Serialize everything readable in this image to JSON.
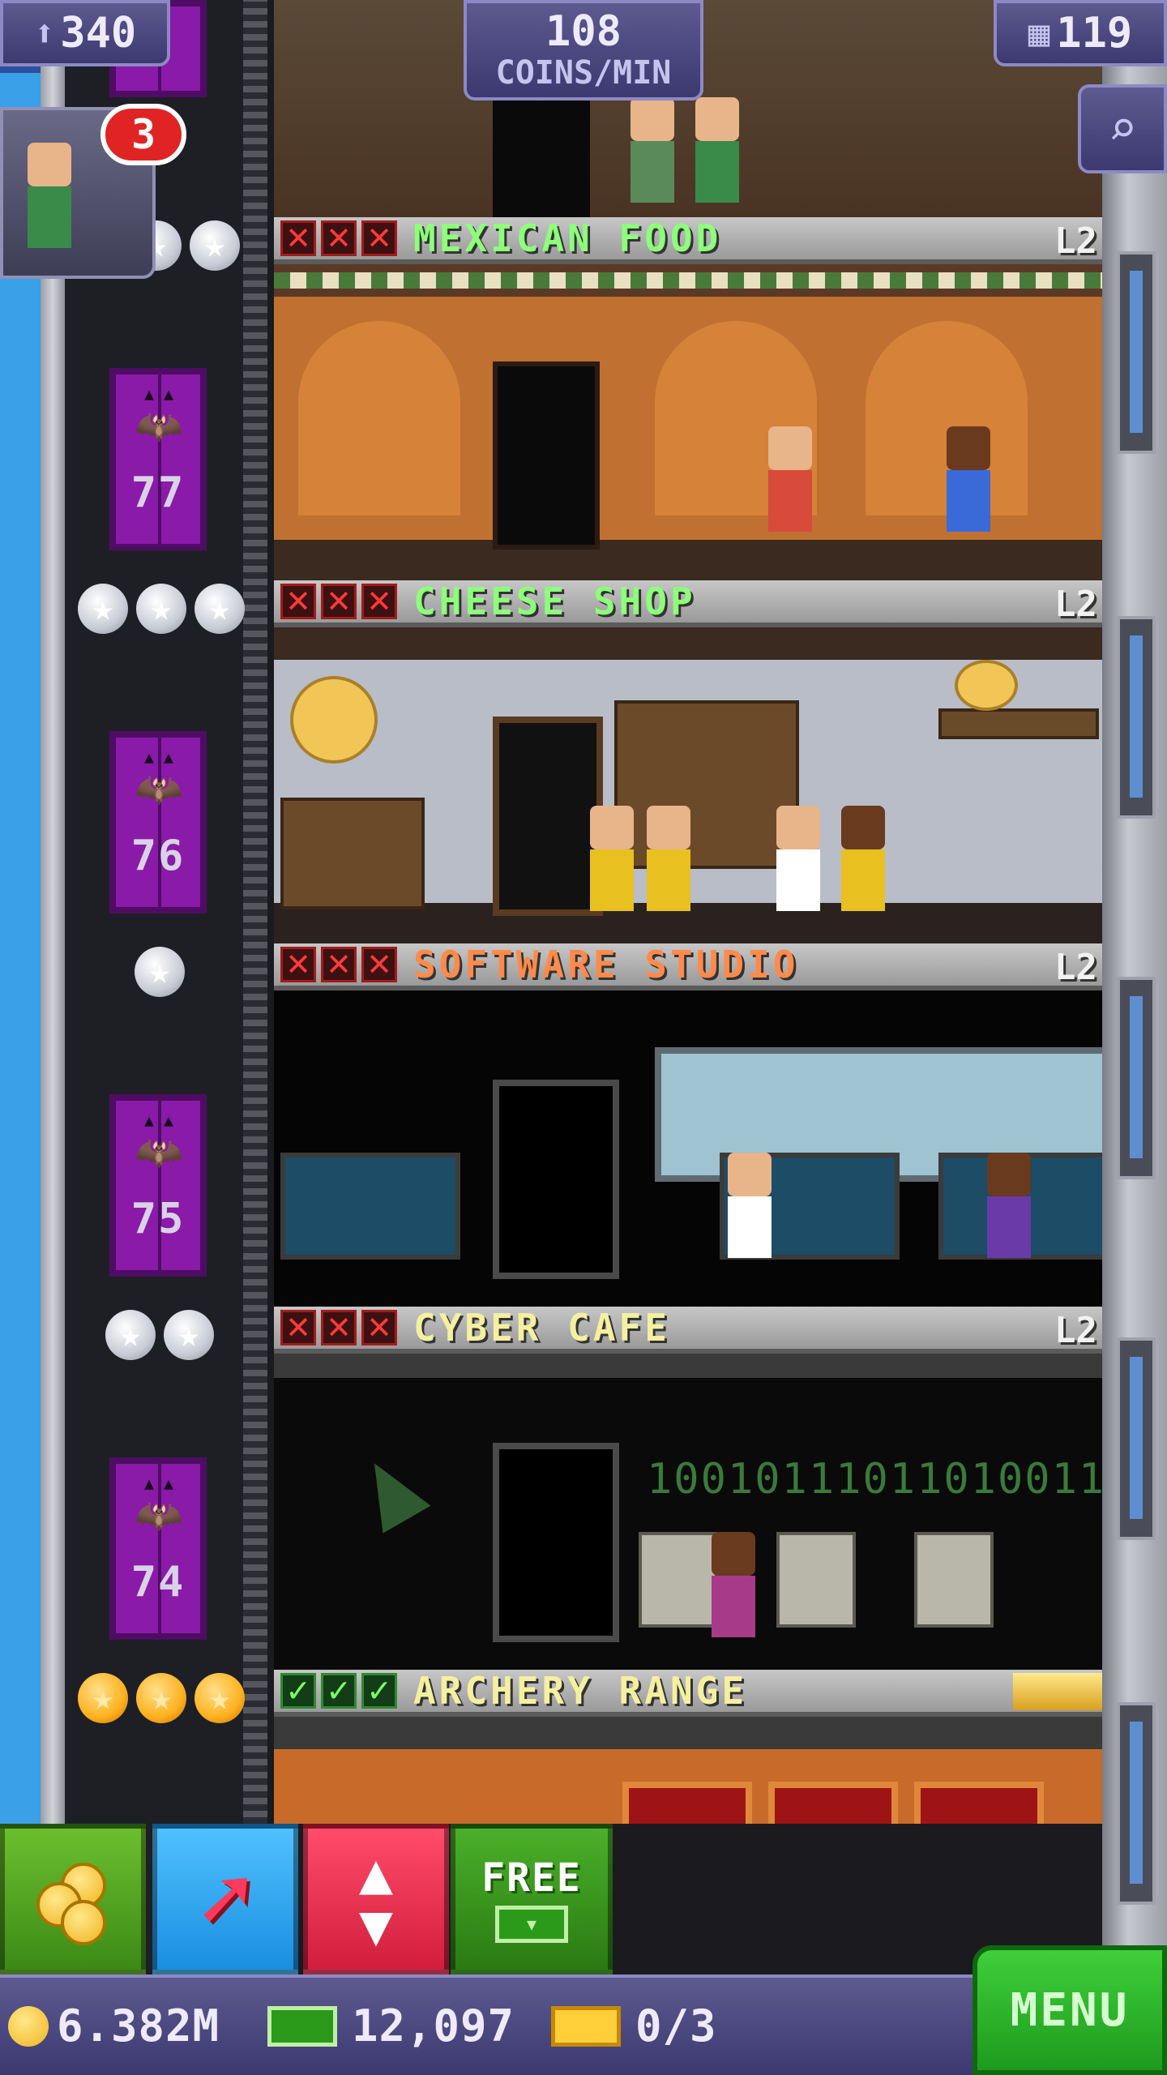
{
  "hud": {
    "population": "340",
    "coins_per_min_amount": "108",
    "coins_per_min_unit": "COINS/MIN",
    "floors": "119",
    "notification_count": "3"
  },
  "floors": [
    {
      "name": "MEXICAN FOOD",
      "level": "L2",
      "name_color": "#8dff7a",
      "status": [
        "x",
        "x",
        "x"
      ],
      "stars": 2,
      "star_type": "silver",
      "floor_number": "77"
    },
    {
      "name": "CHEESE SHOP",
      "level": "L2",
      "name_color": "#8dff7a",
      "status": [
        "x",
        "x",
        "x"
      ],
      "stars": 3,
      "star_type": "silver",
      "floor_number": "76"
    },
    {
      "name": "SOFTWARE STUDIO",
      "level": "L2",
      "name_color": "#ff8a4a",
      "status": [
        "x",
        "x",
        "x"
      ],
      "stars": 1,
      "star_type": "silver",
      "floor_number": "75"
    },
    {
      "name": "CYBER CAFE",
      "level": "L2",
      "name_color": "#f4f0a0",
      "status": [
        "x",
        "x",
        "x"
      ],
      "stars": 2,
      "star_type": "silver",
      "floor_number": "74"
    },
    {
      "name": "ARCHERY RANGE",
      "level": "",
      "name_color": "#f4f0a0",
      "status": [
        "check",
        "check",
        "check"
      ],
      "stars": 3,
      "star_type": "gold",
      "floor_number": ""
    }
  ],
  "cyber_binary": "10010111011010011",
  "toolbar": {
    "free_label": "FREE"
  },
  "currency": {
    "coins": "6.382M",
    "bux": "12,097",
    "tickets": "0/3"
  },
  "menu_label": "MENU",
  "colors": {
    "hud_purple": "#4b4880",
    "menu_green": "#2eb82a",
    "elevator_purple": "#8a1aa8"
  }
}
